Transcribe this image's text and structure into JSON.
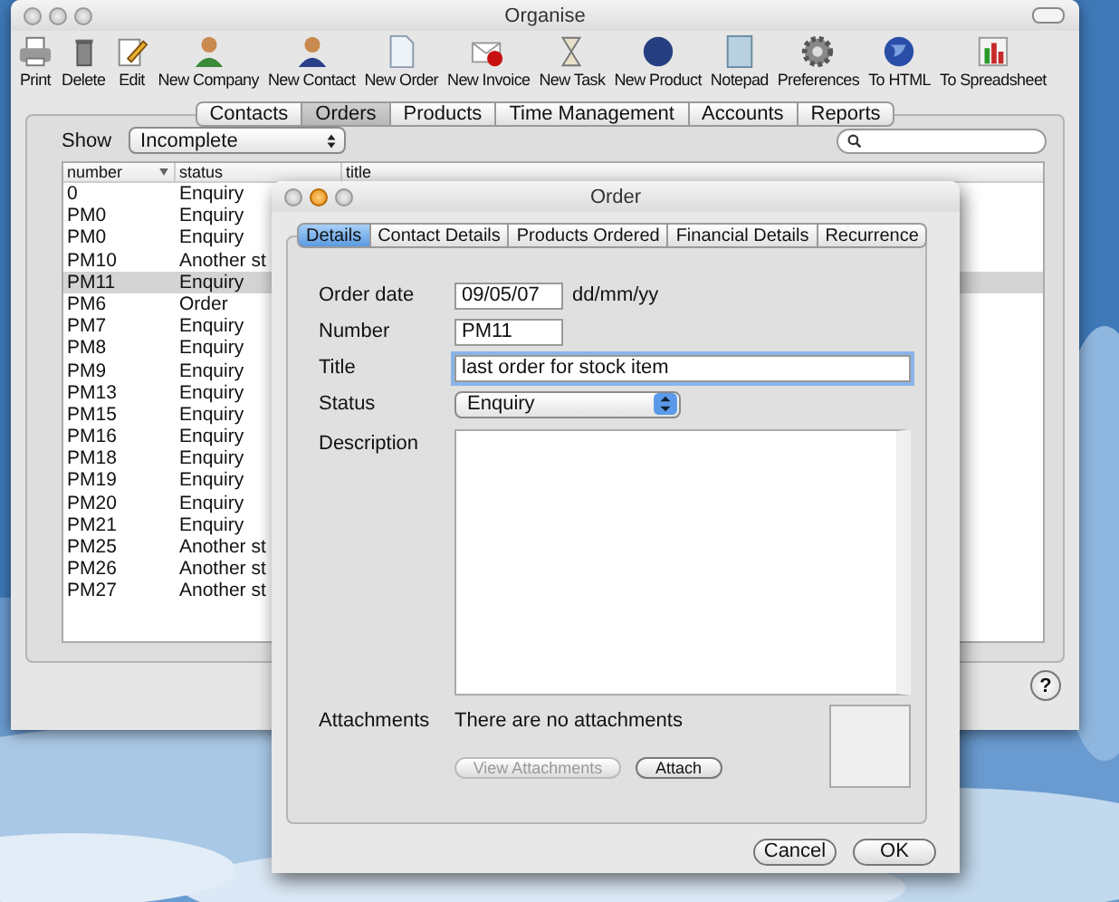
{
  "main_window": {
    "title": "Organise",
    "toolbar": [
      {
        "label": "Print"
      },
      {
        "label": "Delete"
      },
      {
        "label": "Edit"
      },
      {
        "label": "New Company"
      },
      {
        "label": "New Contact"
      },
      {
        "label": "New Order"
      },
      {
        "label": "New Invoice"
      },
      {
        "label": "New Task"
      },
      {
        "label": "New Product"
      },
      {
        "label": "Notepad"
      },
      {
        "label": "Preferences"
      },
      {
        "label": "To HTML"
      },
      {
        "label": "To Spreadsheet"
      }
    ],
    "tabs": [
      {
        "label": "Contacts",
        "selected": false
      },
      {
        "label": "Orders",
        "selected": true
      },
      {
        "label": "Products",
        "selected": false
      },
      {
        "label": "Time Management",
        "selected": false
      },
      {
        "label": "Accounts",
        "selected": false
      },
      {
        "label": "Reports",
        "selected": false
      }
    ],
    "show": {
      "label": "Show",
      "value": "Incomplete"
    },
    "table": {
      "columns": [
        "number",
        "status",
        "title"
      ],
      "rows": [
        {
          "number": "0",
          "status": "Enquiry",
          "selected": false
        },
        {
          "number": "PM0",
          "status": "Enquiry",
          "selected": false
        },
        {
          "number": "PM0",
          "status": "Enquiry",
          "selected": false
        },
        {
          "number": "PM10",
          "status": "Another st",
          "selected": false
        },
        {
          "number": "PM11",
          "status": "Enquiry",
          "selected": true
        },
        {
          "number": "PM6",
          "status": "Order",
          "selected": false
        },
        {
          "number": "PM7",
          "status": "Enquiry",
          "selected": false
        },
        {
          "number": "PM8",
          "status": "Enquiry",
          "selected": false
        },
        {
          "number": "PM9",
          "status": "Enquiry",
          "selected": false
        },
        {
          "number": "PM13",
          "status": "Enquiry",
          "selected": false
        },
        {
          "number": "PM15",
          "status": "Enquiry",
          "selected": false
        },
        {
          "number": "PM16",
          "status": "Enquiry",
          "selected": false
        },
        {
          "number": "PM18",
          "status": "Enquiry",
          "selected": false
        },
        {
          "number": "PM19",
          "status": "Enquiry",
          "selected": false
        },
        {
          "number": "PM20",
          "status": "Enquiry",
          "selected": false
        },
        {
          "number": "PM21",
          "status": "Enquiry",
          "selected": false
        },
        {
          "number": "PM25",
          "status": "Another st",
          "selected": false
        },
        {
          "number": "PM26",
          "status": "Another st",
          "selected": false
        },
        {
          "number": "PM27",
          "status": "Another st",
          "selected": false
        }
      ]
    },
    "help_button": "?"
  },
  "dialog": {
    "title": "Order",
    "tabs": [
      {
        "label": "Details",
        "selected": true
      },
      {
        "label": "Contact Details",
        "selected": false
      },
      {
        "label": "Products Ordered",
        "selected": false
      },
      {
        "label": "Financial Details",
        "selected": false
      },
      {
        "label": "Recurrence",
        "selected": false
      }
    ],
    "fields": [
      {
        "kind": "short",
        "label": "Order date",
        "value": "09/05/07",
        "note": "dd/mm/yy"
      },
      {
        "kind": "short",
        "label": "Number",
        "value": "PM11"
      },
      {
        "kind": "wide",
        "label": "Title",
        "value": "last order for stock item",
        "focused": true
      },
      {
        "kind": "popup",
        "label": "Status",
        "value": "Enquiry"
      },
      {
        "kind": "textarea",
        "label": "Description"
      }
    ],
    "attachments": {
      "label": "Attachments",
      "text": "There are no attachments",
      "buttons": [
        {
          "label": "View Attachments",
          "disabled": true
        },
        {
          "label": "Attach",
          "disabled": false
        }
      ]
    },
    "buttons": [
      "Cancel",
      "OK"
    ]
  }
}
